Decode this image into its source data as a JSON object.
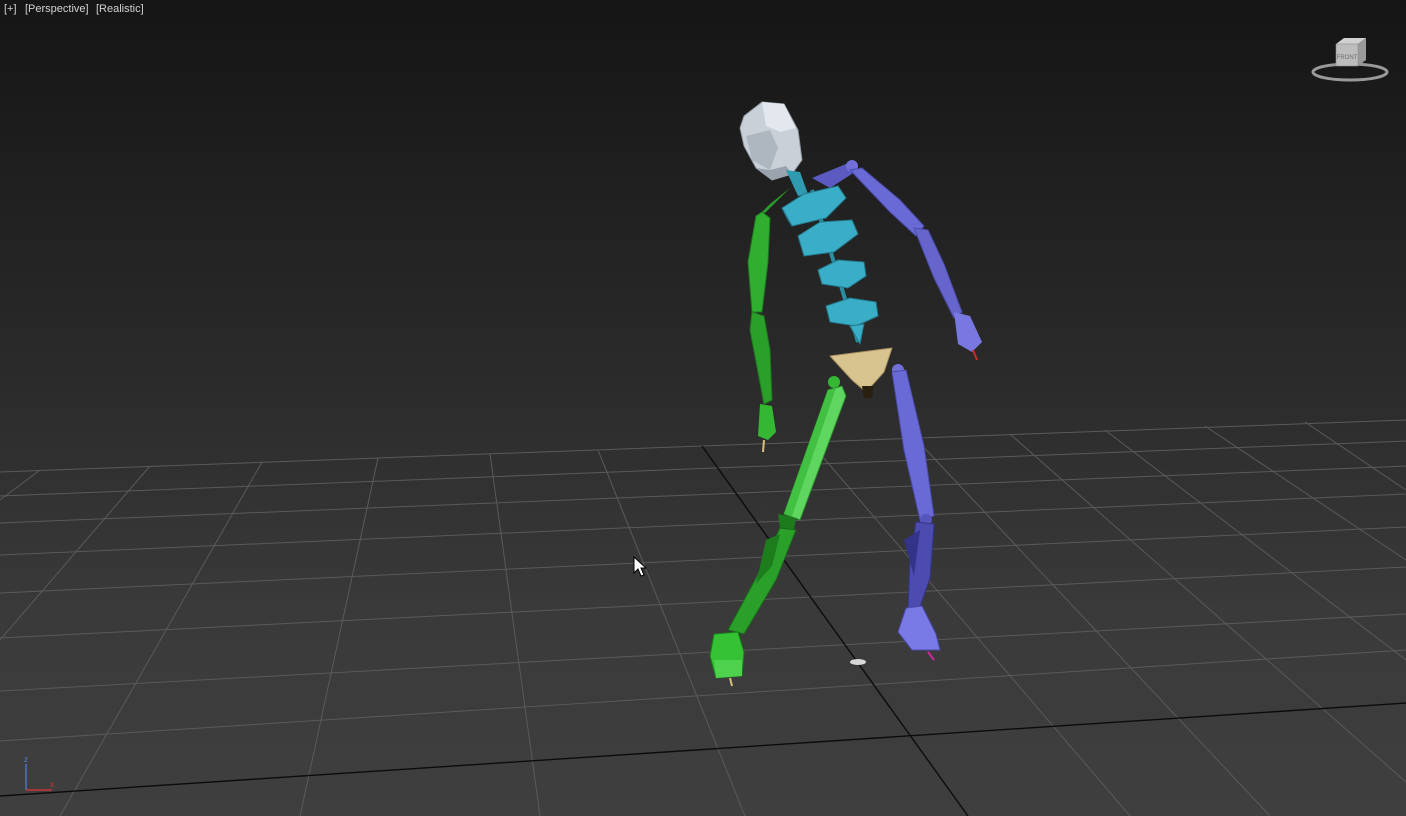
{
  "viewport": {
    "labels": {
      "menu": "[+]",
      "view": "[Perspective]",
      "shading": "[Realistic]"
    },
    "viewcube": {
      "face_label": "FRONT",
      "icon": "viewcube-icon"
    },
    "axis_tripod": {
      "z": "z",
      "x": "x",
      "icon": "axis-tripod-icon"
    },
    "cursor": {
      "icon": "mouse-pointer-icon"
    }
  },
  "scene": {
    "object": "biped-skeleton",
    "colors": {
      "left_side": "#2fa82f",
      "right_side": "#6565cc",
      "spine": "#3aa8c0",
      "head": "#c9d0d8",
      "pelvis": "#d8c48e",
      "grid": "#565656",
      "grid_axis": "#0a0a0a",
      "background_top": "#151515",
      "background_bottom": "#3f3f3f"
    }
  }
}
